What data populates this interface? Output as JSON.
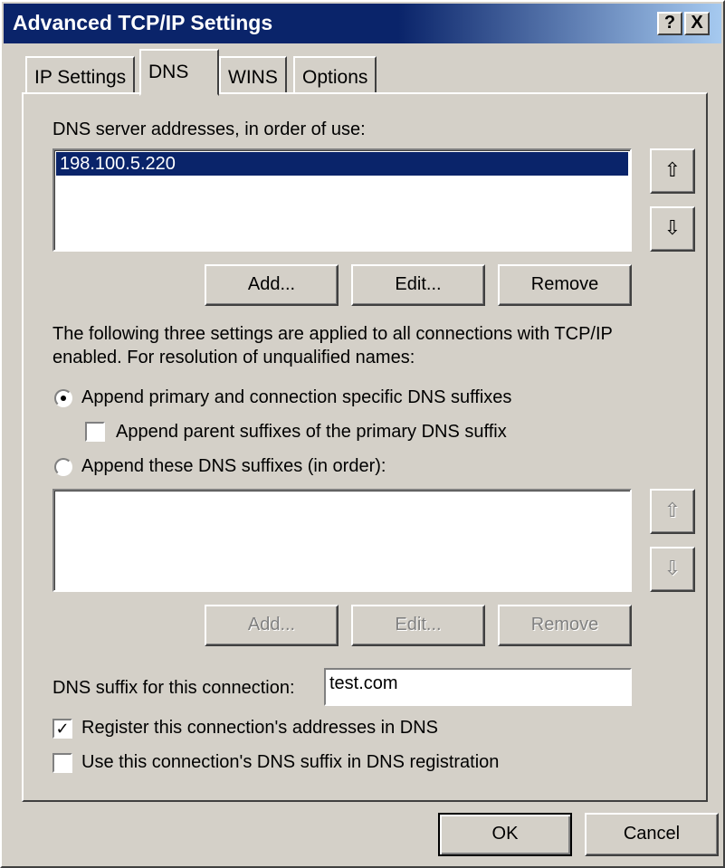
{
  "window": {
    "title": "Advanced TCP/IP Settings",
    "help_button": "?",
    "close_button": "X"
  },
  "tabs": [
    {
      "label": "IP Settings",
      "active": false
    },
    {
      "label": "DNS",
      "active": true
    },
    {
      "label": "WINS",
      "active": false
    },
    {
      "label": "Options",
      "active": false
    }
  ],
  "dns_servers": {
    "label": "DNS server addresses, in order of use:",
    "items": [
      "198.100.5.220"
    ],
    "selected_index": 0,
    "up_icon": "arrow-up-icon",
    "down_icon": "arrow-down-icon",
    "add_label": "Add...",
    "edit_label": "Edit...",
    "remove_label": "Remove"
  },
  "description": {
    "line1": "The following three settings are applied to all connections with TCP/IP",
    "line2": "enabled. For resolution of unqualified names:"
  },
  "options": {
    "append_primary_label": "Append primary and connection specific DNS suffixes",
    "append_primary_selected": true,
    "append_parent_label": "Append parent suffixes of the primary DNS suffix",
    "append_parent_checked": false,
    "append_these_label": "Append these DNS suffixes (in order):",
    "append_these_selected": false
  },
  "suffixes": {
    "items": [],
    "add_label": "Add...",
    "edit_label": "Edit...",
    "remove_label": "Remove",
    "enabled": false
  },
  "connection_suffix": {
    "label": "DNS suffix for this connection:",
    "value": "test.com"
  },
  "register": {
    "label": "Register this connection's addresses in DNS",
    "checked": true
  },
  "use_suffix": {
    "label": "Use this connection's DNS suffix in DNS registration",
    "checked": false
  },
  "footer": {
    "ok_label": "OK",
    "cancel_label": "Cancel"
  },
  "colors": {
    "face": "#d4d0c8",
    "title_start": "#0a246a",
    "title_end": "#a6caf0",
    "selection": "#0a246a"
  }
}
